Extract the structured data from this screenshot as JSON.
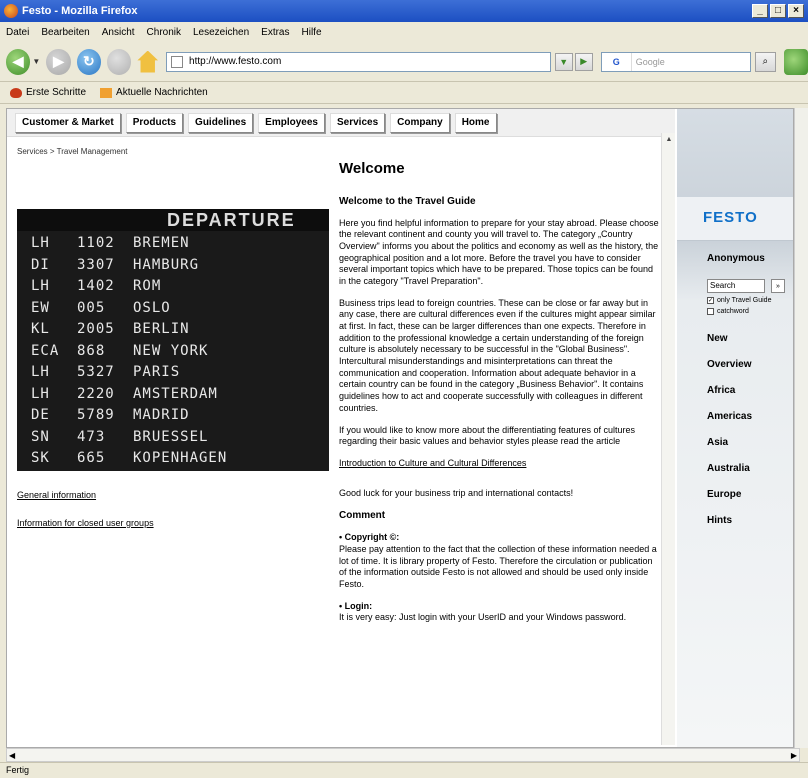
{
  "window": {
    "title": "Festo - Mozilla Firefox"
  },
  "menu": [
    "Datei",
    "Bearbeiten",
    "Ansicht",
    "Chronik",
    "Lesezeichen",
    "Extras",
    "Hilfe"
  ],
  "url": "http://www.festo.com",
  "search": {
    "engine": "G",
    "placeholder": "Google"
  },
  "bookmarks": [
    "Erste Schritte",
    "Aktuelle Nachrichten"
  ],
  "topnav": [
    "Customer & Market",
    "Products",
    "Guidelines",
    "Employees",
    "Services",
    "Company",
    "Home"
  ],
  "breadcrumb": "Services > Travel Management",
  "board": {
    "header": "DEPARTURE",
    "rows": [
      {
        "code": "LH",
        "num": "1102",
        "city": "BREMEN"
      },
      {
        "code": "DI",
        "num": "3307",
        "city": "HAMBURG"
      },
      {
        "code": "LH",
        "num": "1402",
        "city": "ROM"
      },
      {
        "code": "EW",
        "num": "005",
        "city": "OSLO"
      },
      {
        "code": "KL",
        "num": "2005",
        "city": "BERLIN"
      },
      {
        "code": "ECA",
        "num": "868",
        "city": "NEW YORK"
      },
      {
        "code": "LH",
        "num": "5327",
        "city": "PARIS"
      },
      {
        "code": "LH",
        "num": "2220",
        "city": "AMSTERDAM"
      },
      {
        "code": "DE",
        "num": "5789",
        "city": "MADRID"
      },
      {
        "code": "SN",
        "num": "473",
        "city": "BRUESSEL"
      },
      {
        "code": "SK",
        "num": "665",
        "city": "KOPENHAGEN"
      }
    ]
  },
  "left_links": [
    "General information",
    "Information for closed user groups"
  ],
  "main": {
    "title": "Welcome",
    "subtitle": "Welcome to the Travel Guide",
    "p1": "Here you find helpful information to prepare for your stay abroad. Please choose the relevant continent and county you will travel to. The category „Country Overview\" informs you about the politics and economy as well as the history, the geographical position and a lot more. Before the travel you have to consider several important topics which have to be prepared. Those topics can be found in the category \"Travel Preparation\".",
    "p2": "Business trips lead to foreign countries. These can be close or far away but in any case, there are cultural differences even if the cultures might appear similar at first. In fact, these can be larger differences than one expects. Therefore in addition to the professional knowledge a certain understanding of the foreign culture is absolutely necessary to be successful in the \"Global Business\". Intercultural misunderstandings and misinterpretations can threat the communication and cooperation. Information about adequate behavior in a certain country can be found in the category „Business Behavior\". It contains guidelines how to act and cooperate successfully with colleagues in different countries.",
    "p3": "If you would like to know more about the differentiating features of cultures regarding their basic values and behavior styles please read the article",
    "link": "Introduction to Culture and Cultural Differences",
    "p4": "Good luck for your business trip and international contacts!",
    "comment_title": "Comment",
    "b1_title": "• Copyright ©:",
    "b1_text": "Please pay attention to the fact that the collection of these information needed a lot of time. It is library property of Festo. Therefore the circulation or publication of the information outside Festo is not allowed and should be used only inside Festo.",
    "b2_title": "• Login:",
    "b2_text": "It is very easy: Just login with your UserID and your Windows password."
  },
  "sidebar": {
    "logo": "FESTO",
    "user": "Anonymous",
    "search_value": "Search",
    "check1": "only Travel Guide",
    "check2": "catchword",
    "items": [
      "New",
      "Overview",
      "Africa",
      "Americas",
      "Asia",
      "Australia",
      "Europe",
      "Hints"
    ]
  },
  "status": "Fertig"
}
